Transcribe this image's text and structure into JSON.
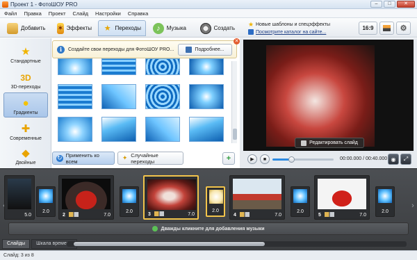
{
  "window": {
    "title": "Проект 1 - ФотоШОУ PRO",
    "minimize": "–",
    "maximize": "□",
    "close": "✕"
  },
  "menu": [
    "Файл",
    "Правка",
    "Проект",
    "Слайд",
    "Настройки",
    "Справка"
  ],
  "tabs": [
    {
      "label": "Добавить",
      "icon": "folder-icon"
    },
    {
      "label": "Эффекты",
      "icon": "effects-icon"
    },
    {
      "label": "Переходы",
      "icon": "star-icon"
    },
    {
      "label": "Музыка",
      "icon": "music-icon"
    },
    {
      "label": "Создать",
      "icon": "film-reel-icon"
    }
  ],
  "active_tab": "Переходы",
  "hints": {
    "templates": "Новые шаблоны и спецэффекты",
    "catalog": "Посмотрите каталог на сайте..."
  },
  "aspect_ratio": "16:9",
  "categories": [
    {
      "label": "Стандартные",
      "icon": "star-icon"
    },
    {
      "label": "3D-переходы",
      "icon": "3d-icon",
      "glyph": "3D"
    },
    {
      "label": "Градиенты",
      "icon": "gradient-icon"
    },
    {
      "label": "Современные",
      "icon": "modern-icon"
    },
    {
      "label": "Двойные",
      "icon": "double-icon"
    }
  ],
  "active_category": "Градиенты",
  "notice": {
    "text": "Создайте свои переходы для ФотоШОУ PRO...",
    "button": "Подробнее..."
  },
  "buttons": {
    "apply_all": "Применить ко всем",
    "random": "Случайные переходы",
    "edit_slide": "Редактировать слайд"
  },
  "player": {
    "time": "00:00.000 / 00:40.000",
    "progress": 0.31
  },
  "timeline": {
    "slides": [
      {
        "num": "",
        "duration": "5.0"
      },
      {
        "num": "2",
        "duration": "7.0"
      },
      {
        "num": "3",
        "duration": "7.0"
      },
      {
        "num": "4",
        "duration": "7.0"
      },
      {
        "num": "5",
        "duration": "7.0"
      }
    ],
    "transitions": [
      "2.0",
      "2.0",
      "2.0",
      "2.0",
      "2.0"
    ],
    "music_hint": "Дважды кликните для добавления музыки",
    "tabs": [
      "Слайды",
      "Шкала времени"
    ],
    "active_tab": "Слайды"
  },
  "status": "Слайд: 3 из 8",
  "colors": {
    "accent": "#2c8ae0",
    "selection": "#f2c44b",
    "close": "#c3402b"
  }
}
